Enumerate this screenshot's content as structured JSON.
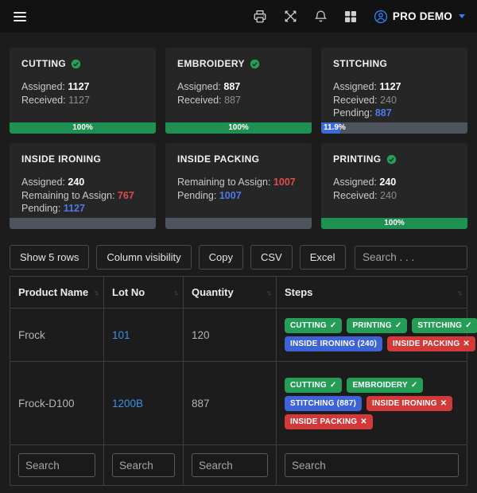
{
  "colors": {
    "card_bg": "#262626",
    "page_bg": "#1c1c1c",
    "topbar_bg": "#121212",
    "progress_green": "#1f8f52",
    "badge_green": "#259d57",
    "badge_blue": "#3d63d6",
    "badge_red": "#d23a3a",
    "link_blue": "#3f8ee8",
    "pending_blue": "#4f7ae8",
    "remaining_red": "#e04b4b",
    "accent_blue": "#2f81f7"
  },
  "topbar": {
    "icons": [
      "print",
      "fullscreen",
      "notifications",
      "apps"
    ],
    "user": {
      "label": "PRO DEMO"
    }
  },
  "cards": [
    {
      "title": "CUTTING",
      "completed": true,
      "lines": [
        {
          "label": "Assigned:",
          "value": "1127"
        },
        {
          "label": "Received:",
          "value": "1127"
        }
      ],
      "progress": {
        "percent": 100,
        "label": "100%"
      }
    },
    {
      "title": "EMBROIDERY",
      "completed": true,
      "lines": [
        {
          "label": "Assigned:",
          "value": "887"
        },
        {
          "label": "Received:",
          "value": "887"
        }
      ],
      "progress": {
        "percent": 100,
        "label": "100%"
      }
    },
    {
      "title": "STITCHING",
      "completed": false,
      "lines": [
        {
          "label": "Assigned:",
          "value": "1127"
        },
        {
          "label": "Received:",
          "value": "240"
        },
        {
          "label": "Pending:",
          "value": "887"
        }
      ],
      "progress": {
        "percent": 11.9,
        "label": "11.9%"
      }
    },
    {
      "title": "INSIDE IRONING",
      "completed": false,
      "lines": [
        {
          "label": "Assigned:",
          "value": "240"
        },
        {
          "label": "Remaining to Assign:",
          "value": "767"
        },
        {
          "label": "Pending:",
          "value": "1127"
        }
      ],
      "progress": {
        "percent": 0,
        "label": ""
      }
    },
    {
      "title": "INSIDE PACKING",
      "completed": false,
      "lines": [
        {
          "label": "Remaining to Assign:",
          "value": "1007"
        },
        {
          "label": "Pending:",
          "value": "1007"
        }
      ],
      "progress": {
        "percent": 0,
        "label": ""
      }
    },
    {
      "title": "PRINTING",
      "completed": true,
      "lines": [
        {
          "label": "Assigned:",
          "value": "240"
        },
        {
          "label": "Received:",
          "value": "240"
        }
      ],
      "progress": {
        "percent": 100,
        "label": "100%"
      }
    }
  ],
  "toolbar": {
    "buttons": [
      "Show 5 rows",
      "Column visibility",
      "Copy",
      "CSV",
      "Excel"
    ],
    "search_placeholder": "Search . . ."
  },
  "table": {
    "headers": [
      {
        "label": "Product Name"
      },
      {
        "label": "Lot No"
      },
      {
        "label": "Quantity"
      },
      {
        "label": "Steps"
      }
    ],
    "sort_icon": "↑↓",
    "rows": [
      {
        "product": "Frock",
        "lot": "101",
        "quantity": "120",
        "steps": [
          [
            {
              "text": "CUTTING",
              "mark": "✓",
              "type": "green"
            },
            {
              "text": "PRINTING",
              "mark": "✓",
              "type": "green"
            },
            {
              "text": "STITCHING",
              "mark": "✓",
              "type": "green"
            }
          ],
          [
            {
              "text": "INSIDE IRONING (240)",
              "mark": "",
              "type": "blue"
            },
            {
              "text": "INSIDE PACKING",
              "mark": "✕",
              "type": "red"
            }
          ]
        ]
      },
      {
        "product": "Frock-D100",
        "lot": "1200B",
        "quantity": "887",
        "steps": [
          [
            {
              "text": "CUTTING",
              "mark": "✓",
              "type": "green"
            },
            {
              "text": "EMBROIDERY",
              "mark": "✓",
              "type": "green"
            }
          ],
          [
            {
              "text": "STITCHING (887)",
              "mark": "",
              "type": "blue"
            },
            {
              "text": "INSIDE IRONING",
              "mark": "✕",
              "type": "red"
            }
          ],
          [
            {
              "text": "INSIDE PACKING",
              "mark": "✕",
              "type": "red"
            }
          ]
        ]
      }
    ],
    "column_search_placeholder": "Search"
  }
}
